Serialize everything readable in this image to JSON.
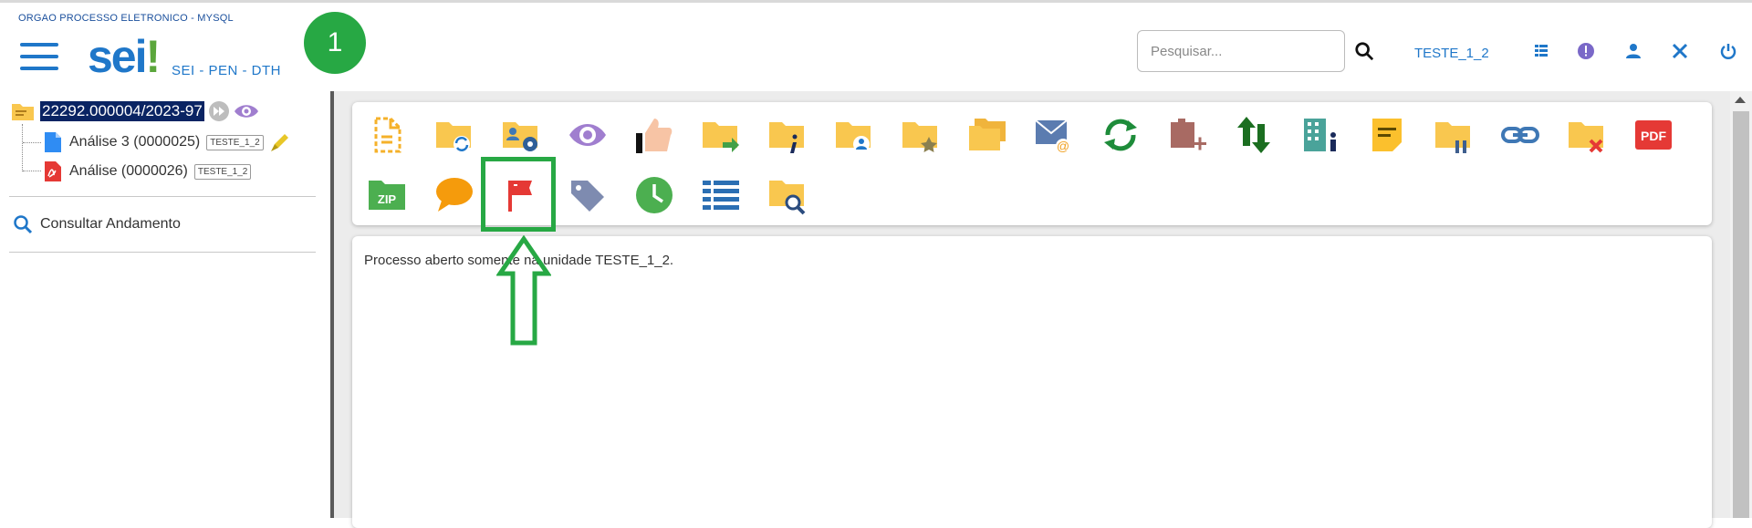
{
  "header": {
    "org_name": "ORGAO PROCESSO ELETRONICO - MYSQL",
    "logo_text": "sei",
    "logo_dot": "!",
    "system_name": "SEI - PEN - DTH",
    "step_badge": "1",
    "search_placeholder": "Pesquisar...",
    "unit": "TESTE_1_2",
    "icons": [
      "grid-menu-icon",
      "alert-icon",
      "user-icon",
      "tools-icon",
      "power-icon"
    ]
  },
  "tree": {
    "process_number": "22292.000004/2023-97",
    "documents": [
      {
        "label": "Análise 3 (0000025)",
        "unit": "TESTE_1_2",
        "type": "doc",
        "has_pen": true
      },
      {
        "label": "Análise (0000026)",
        "unit": "TESTE_1_2",
        "type": "pdf",
        "has_pen": false
      }
    ],
    "consult_label": "Consultar Andamento"
  },
  "toolbar": {
    "row1": [
      "new-document-icon",
      "folder-sync-icon",
      "folder-settings-icon",
      "eye-icon",
      "thumbs-up-icon",
      "folder-forward-icon",
      "folder-info-icon",
      "folder-user-icon",
      "folder-star-icon",
      "folders-icon",
      "email-icon",
      "refresh-icon",
      "block-add-icon",
      "swap-arrows-icon",
      "building-icon",
      "note-icon",
      "folder-pause-icon",
      "link-icon",
      "folder-remove-icon",
      "pdf-icon"
    ],
    "row2": [
      "zip-icon",
      "comment-icon",
      "flag-icon",
      "tag-icon",
      "clock-icon",
      "list-icon",
      "folder-search-icon"
    ],
    "pdf_text": "PDF",
    "zip_text": "ZIP"
  },
  "content": {
    "status_text": "Processo aberto somente na unidade TESTE_1_2."
  },
  "colors": {
    "accent": "#1f77c9",
    "highlight": "#27a844",
    "folder": "#f9c74f",
    "flag": "#e53935"
  }
}
